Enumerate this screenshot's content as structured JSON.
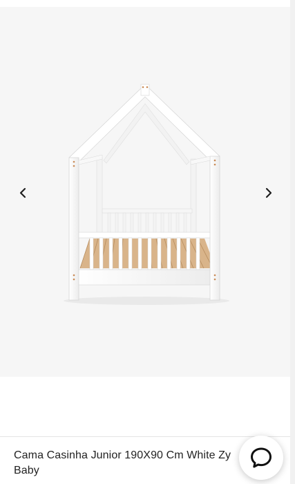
{
  "product": {
    "title": "Cama Casinha Junior 190X90 Cm White Zy Baby",
    "image_alt": "house-shaped white toddler bed with wooden slats"
  },
  "gallery": {
    "prev_icon": "chevron-left-icon",
    "next_icon": "chevron-right-icon"
  },
  "chat": {
    "icon": "chat-bubble-icon"
  },
  "colors": {
    "gallery_bg": "#f6f6f6",
    "bed_frame": "#ffffff",
    "slats": "#dcb98f",
    "accent_dots": "#c98a55",
    "text": "#222222"
  }
}
